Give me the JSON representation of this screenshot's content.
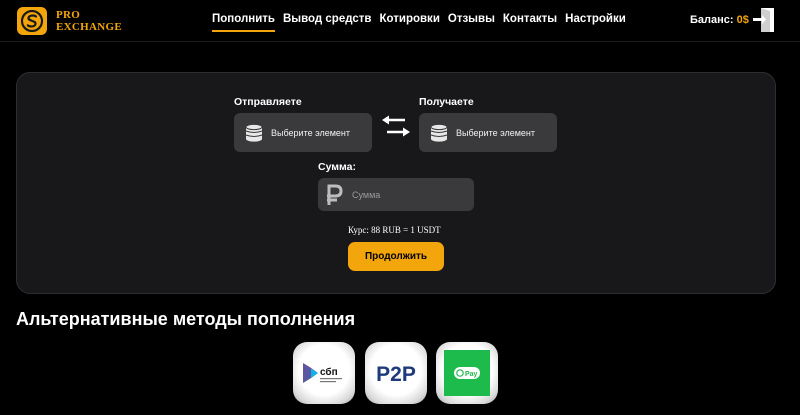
{
  "header": {
    "logo_line1": "PRO",
    "logo_line2": "EXCHANGE",
    "nav": [
      {
        "label": "Пополнить",
        "active": true
      },
      {
        "label": "Вывод средств"
      },
      {
        "label": "Котировки"
      },
      {
        "label": "Отзывы"
      },
      {
        "label": "Контакты"
      },
      {
        "label": "Настройки"
      }
    ],
    "balance_label": "Баланс:",
    "balance_value": "0$"
  },
  "exchange": {
    "send_label": "Отправляете",
    "receive_label": "Получаете",
    "send_select": "Выберите элемент",
    "receive_select": "Выберите элемент",
    "sum_label": "Сумма:",
    "sum_placeholder": "Сумма",
    "rate_text": "Курс: 88 RUB = 1 USDT",
    "continue_label": "Продолжить"
  },
  "alternatives": {
    "title": "Альтернативные методы пополнения",
    "methods": [
      {
        "name": "sbp",
        "label": "сбп"
      },
      {
        "name": "p2p",
        "label": "P2P"
      },
      {
        "name": "pay",
        "label": "Pay"
      }
    ]
  },
  "colors": {
    "accent": "#f3a50c",
    "card": "#18181b",
    "field": "#3a3a3c"
  }
}
